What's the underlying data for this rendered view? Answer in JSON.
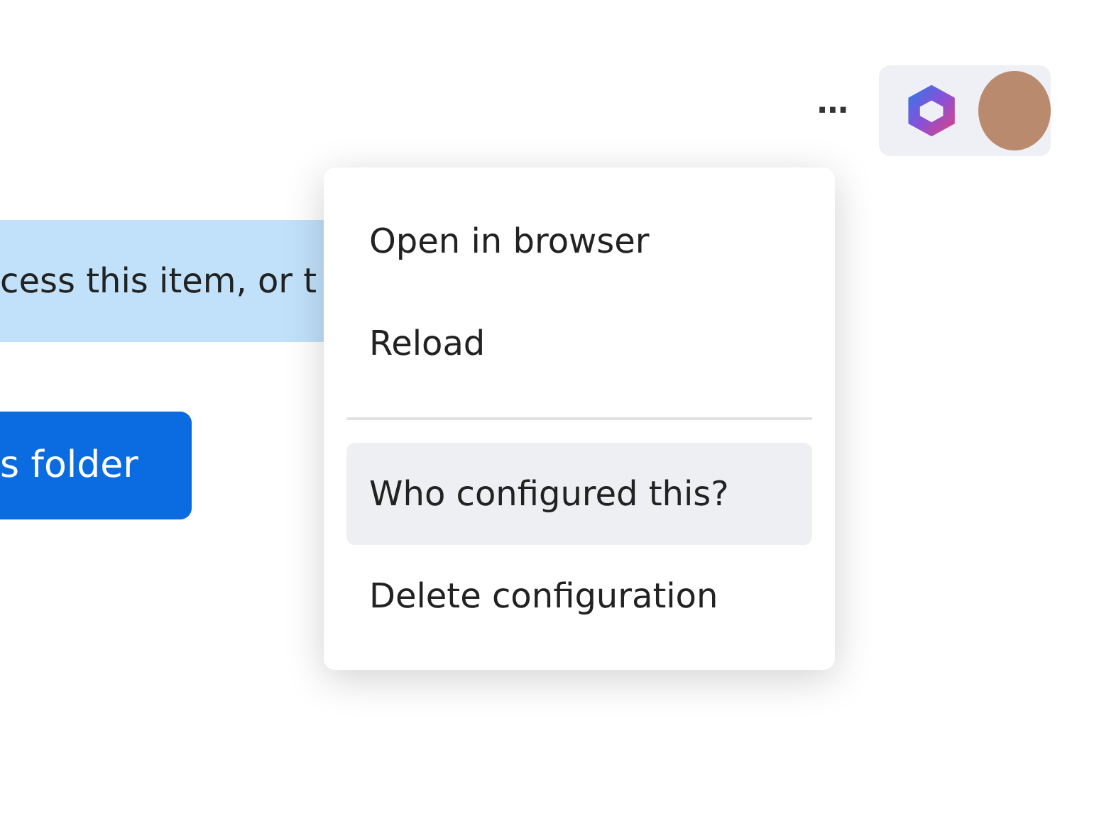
{
  "header": {
    "more_button": "···"
  },
  "banner": {
    "text": "cess this item, or t"
  },
  "action_button": {
    "label": "s folder"
  },
  "menu": {
    "groups": [
      {
        "items": [
          {
            "label": "Open in browser",
            "selected": false
          },
          {
            "label": "Reload",
            "selected": false
          }
        ]
      },
      {
        "items": [
          {
            "label": "Who configured this?",
            "selected": true
          },
          {
            "label": "Delete configuration",
            "selected": false
          }
        ]
      }
    ]
  }
}
